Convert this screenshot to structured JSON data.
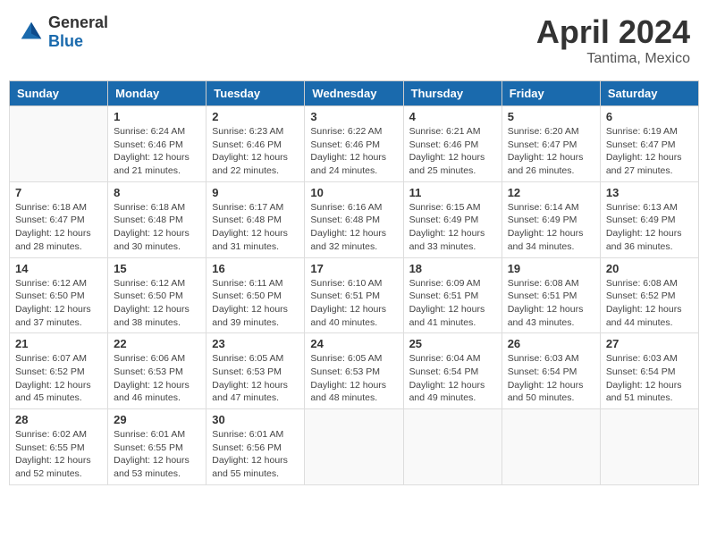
{
  "header": {
    "logo": {
      "general": "General",
      "blue": "Blue"
    },
    "title": "April 2024",
    "location": "Tantima, Mexico"
  },
  "calendar": {
    "days_of_week": [
      "Sunday",
      "Monday",
      "Tuesday",
      "Wednesday",
      "Thursday",
      "Friday",
      "Saturday"
    ],
    "weeks": [
      [
        {
          "day": "",
          "detail": ""
        },
        {
          "day": "1",
          "detail": "Sunrise: 6:24 AM\nSunset: 6:46 PM\nDaylight: 12 hours\nand 21 minutes."
        },
        {
          "day": "2",
          "detail": "Sunrise: 6:23 AM\nSunset: 6:46 PM\nDaylight: 12 hours\nand 22 minutes."
        },
        {
          "day": "3",
          "detail": "Sunrise: 6:22 AM\nSunset: 6:46 PM\nDaylight: 12 hours\nand 24 minutes."
        },
        {
          "day": "4",
          "detail": "Sunrise: 6:21 AM\nSunset: 6:46 PM\nDaylight: 12 hours\nand 25 minutes."
        },
        {
          "day": "5",
          "detail": "Sunrise: 6:20 AM\nSunset: 6:47 PM\nDaylight: 12 hours\nand 26 minutes."
        },
        {
          "day": "6",
          "detail": "Sunrise: 6:19 AM\nSunset: 6:47 PM\nDaylight: 12 hours\nand 27 minutes."
        }
      ],
      [
        {
          "day": "7",
          "detail": "Sunrise: 6:18 AM\nSunset: 6:47 PM\nDaylight: 12 hours\nand 28 minutes."
        },
        {
          "day": "8",
          "detail": "Sunrise: 6:18 AM\nSunset: 6:48 PM\nDaylight: 12 hours\nand 30 minutes."
        },
        {
          "day": "9",
          "detail": "Sunrise: 6:17 AM\nSunset: 6:48 PM\nDaylight: 12 hours\nand 31 minutes."
        },
        {
          "day": "10",
          "detail": "Sunrise: 6:16 AM\nSunset: 6:48 PM\nDaylight: 12 hours\nand 32 minutes."
        },
        {
          "day": "11",
          "detail": "Sunrise: 6:15 AM\nSunset: 6:49 PM\nDaylight: 12 hours\nand 33 minutes."
        },
        {
          "day": "12",
          "detail": "Sunrise: 6:14 AM\nSunset: 6:49 PM\nDaylight: 12 hours\nand 34 minutes."
        },
        {
          "day": "13",
          "detail": "Sunrise: 6:13 AM\nSunset: 6:49 PM\nDaylight: 12 hours\nand 36 minutes."
        }
      ],
      [
        {
          "day": "14",
          "detail": "Sunrise: 6:12 AM\nSunset: 6:50 PM\nDaylight: 12 hours\nand 37 minutes."
        },
        {
          "day": "15",
          "detail": "Sunrise: 6:12 AM\nSunset: 6:50 PM\nDaylight: 12 hours\nand 38 minutes."
        },
        {
          "day": "16",
          "detail": "Sunrise: 6:11 AM\nSunset: 6:50 PM\nDaylight: 12 hours\nand 39 minutes."
        },
        {
          "day": "17",
          "detail": "Sunrise: 6:10 AM\nSunset: 6:51 PM\nDaylight: 12 hours\nand 40 minutes."
        },
        {
          "day": "18",
          "detail": "Sunrise: 6:09 AM\nSunset: 6:51 PM\nDaylight: 12 hours\nand 41 minutes."
        },
        {
          "day": "19",
          "detail": "Sunrise: 6:08 AM\nSunset: 6:51 PM\nDaylight: 12 hours\nand 43 minutes."
        },
        {
          "day": "20",
          "detail": "Sunrise: 6:08 AM\nSunset: 6:52 PM\nDaylight: 12 hours\nand 44 minutes."
        }
      ],
      [
        {
          "day": "21",
          "detail": "Sunrise: 6:07 AM\nSunset: 6:52 PM\nDaylight: 12 hours\nand 45 minutes."
        },
        {
          "day": "22",
          "detail": "Sunrise: 6:06 AM\nSunset: 6:53 PM\nDaylight: 12 hours\nand 46 minutes."
        },
        {
          "day": "23",
          "detail": "Sunrise: 6:05 AM\nSunset: 6:53 PM\nDaylight: 12 hours\nand 47 minutes."
        },
        {
          "day": "24",
          "detail": "Sunrise: 6:05 AM\nSunset: 6:53 PM\nDaylight: 12 hours\nand 48 minutes."
        },
        {
          "day": "25",
          "detail": "Sunrise: 6:04 AM\nSunset: 6:54 PM\nDaylight: 12 hours\nand 49 minutes."
        },
        {
          "day": "26",
          "detail": "Sunrise: 6:03 AM\nSunset: 6:54 PM\nDaylight: 12 hours\nand 50 minutes."
        },
        {
          "day": "27",
          "detail": "Sunrise: 6:03 AM\nSunset: 6:54 PM\nDaylight: 12 hours\nand 51 minutes."
        }
      ],
      [
        {
          "day": "28",
          "detail": "Sunrise: 6:02 AM\nSunset: 6:55 PM\nDaylight: 12 hours\nand 52 minutes."
        },
        {
          "day": "29",
          "detail": "Sunrise: 6:01 AM\nSunset: 6:55 PM\nDaylight: 12 hours\nand 53 minutes."
        },
        {
          "day": "30",
          "detail": "Sunrise: 6:01 AM\nSunset: 6:56 PM\nDaylight: 12 hours\nand 55 minutes."
        },
        {
          "day": "",
          "detail": ""
        },
        {
          "day": "",
          "detail": ""
        },
        {
          "day": "",
          "detail": ""
        },
        {
          "day": "",
          "detail": ""
        }
      ]
    ]
  }
}
